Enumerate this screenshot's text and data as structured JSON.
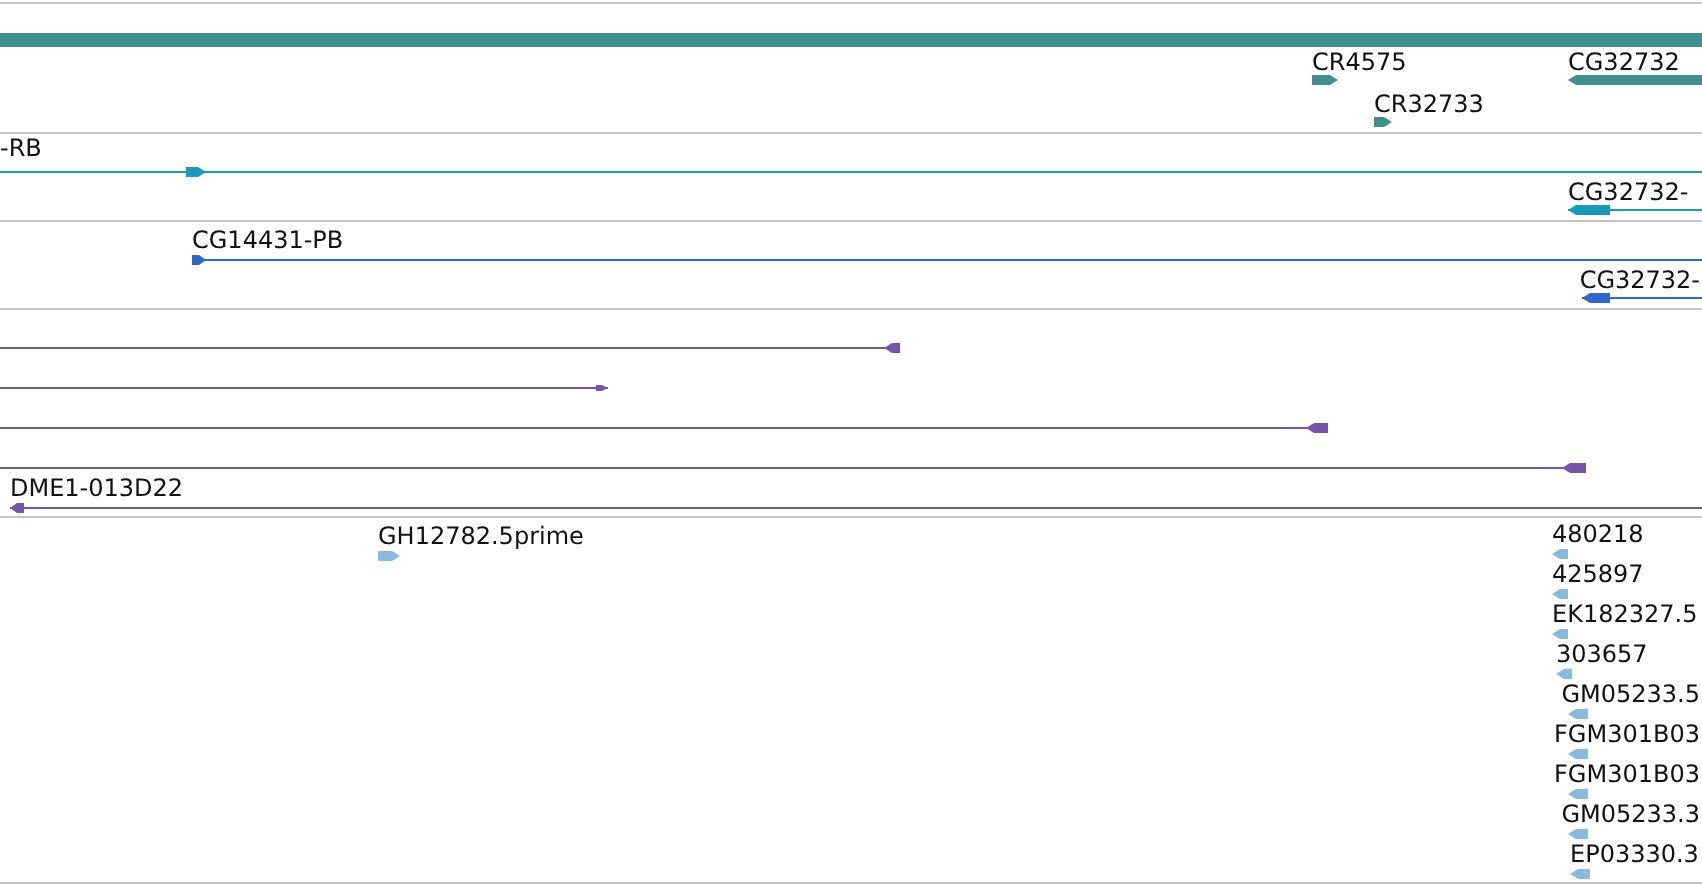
{
  "tracks": [
    {
      "color": "#3f8f8f",
      "features": [
        {
          "kind": "bar"
        },
        {
          "label": "CR4575",
          "kind": "forward"
        },
        {
          "label": "CG32732",
          "kind": "reverse"
        },
        {
          "label": "CR32733",
          "kind": "forward"
        }
      ]
    },
    {
      "color": "#1a9ab8",
      "features": [
        {
          "label": "-RB",
          "kind": "forward"
        },
        {
          "label": "CG32732-",
          "kind": "reverse"
        }
      ]
    },
    {
      "color": "#3366cc",
      "features": [
        {
          "label": "CG14431-PB",
          "kind": "forward"
        },
        {
          "label": "CG32732-",
          "kind": "reverse"
        }
      ]
    },
    {
      "color": "#7755aa",
      "features": [
        {
          "kind": "reverse"
        },
        {
          "kind": "forward"
        },
        {
          "kind": "reverse"
        },
        {
          "kind": "reverse"
        },
        {
          "label": "DME1-013D22",
          "kind": "reverse"
        }
      ]
    },
    {
      "color": "#88bbdd",
      "features": [
        {
          "label": "GH12782.5prime",
          "kind": "forward"
        },
        {
          "label": "480218",
          "kind": "reverse"
        },
        {
          "label": "425897",
          "kind": "reverse"
        },
        {
          "label": "EK182327.5",
          "kind": "reverse"
        },
        {
          "label": "303657",
          "kind": "reverse"
        },
        {
          "label": "GM05233.5",
          "kind": "reverse"
        },
        {
          "label": "FGM301B03",
          "kind": "reverse"
        },
        {
          "label": "FGM301B03",
          "kind": "reverse"
        },
        {
          "label": "GM05233.3",
          "kind": "reverse"
        },
        {
          "label": "EP03330.3",
          "kind": "reverse"
        }
      ]
    }
  ]
}
